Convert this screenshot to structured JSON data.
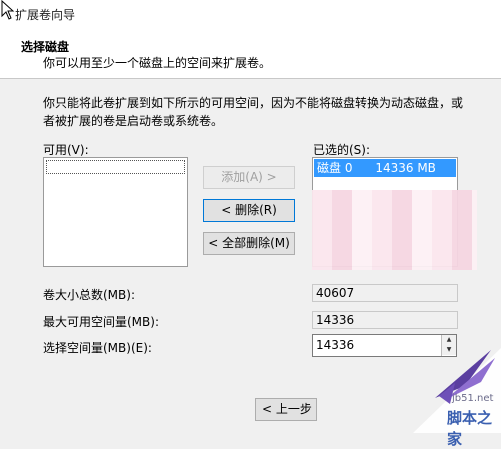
{
  "window": {
    "title": "扩展卷向导"
  },
  "header": {
    "title": "选择磁盘",
    "subtitle": "你可以用至少一个磁盘上的空间来扩展卷。"
  },
  "description": "你只能将此卷扩展到如下所示的可用空间，因为不能将磁盘转换为动态磁盘，或者被扩展的卷是启动卷或系统卷。",
  "available": {
    "label": "可用(V):",
    "items": []
  },
  "selected": {
    "label": "已选的(S):",
    "items": [
      {
        "disk": "磁盘 0",
        "size": "14336 MB"
      }
    ]
  },
  "buttons": {
    "add": "添加(A) >",
    "remove": "< 删除(R)",
    "remove_all": "< 全部删除(M)",
    "back": "< 上一步"
  },
  "fields": {
    "total_label": "卷大小总数(MB):",
    "total_value": "40607",
    "max_label": "最大可用空间量(MB):",
    "max_value": "14336",
    "select_label": "选择空间量(MB)(E):",
    "select_value": "14336"
  },
  "watermark": {
    "site": "jb51.net",
    "name": "脚本之家"
  }
}
